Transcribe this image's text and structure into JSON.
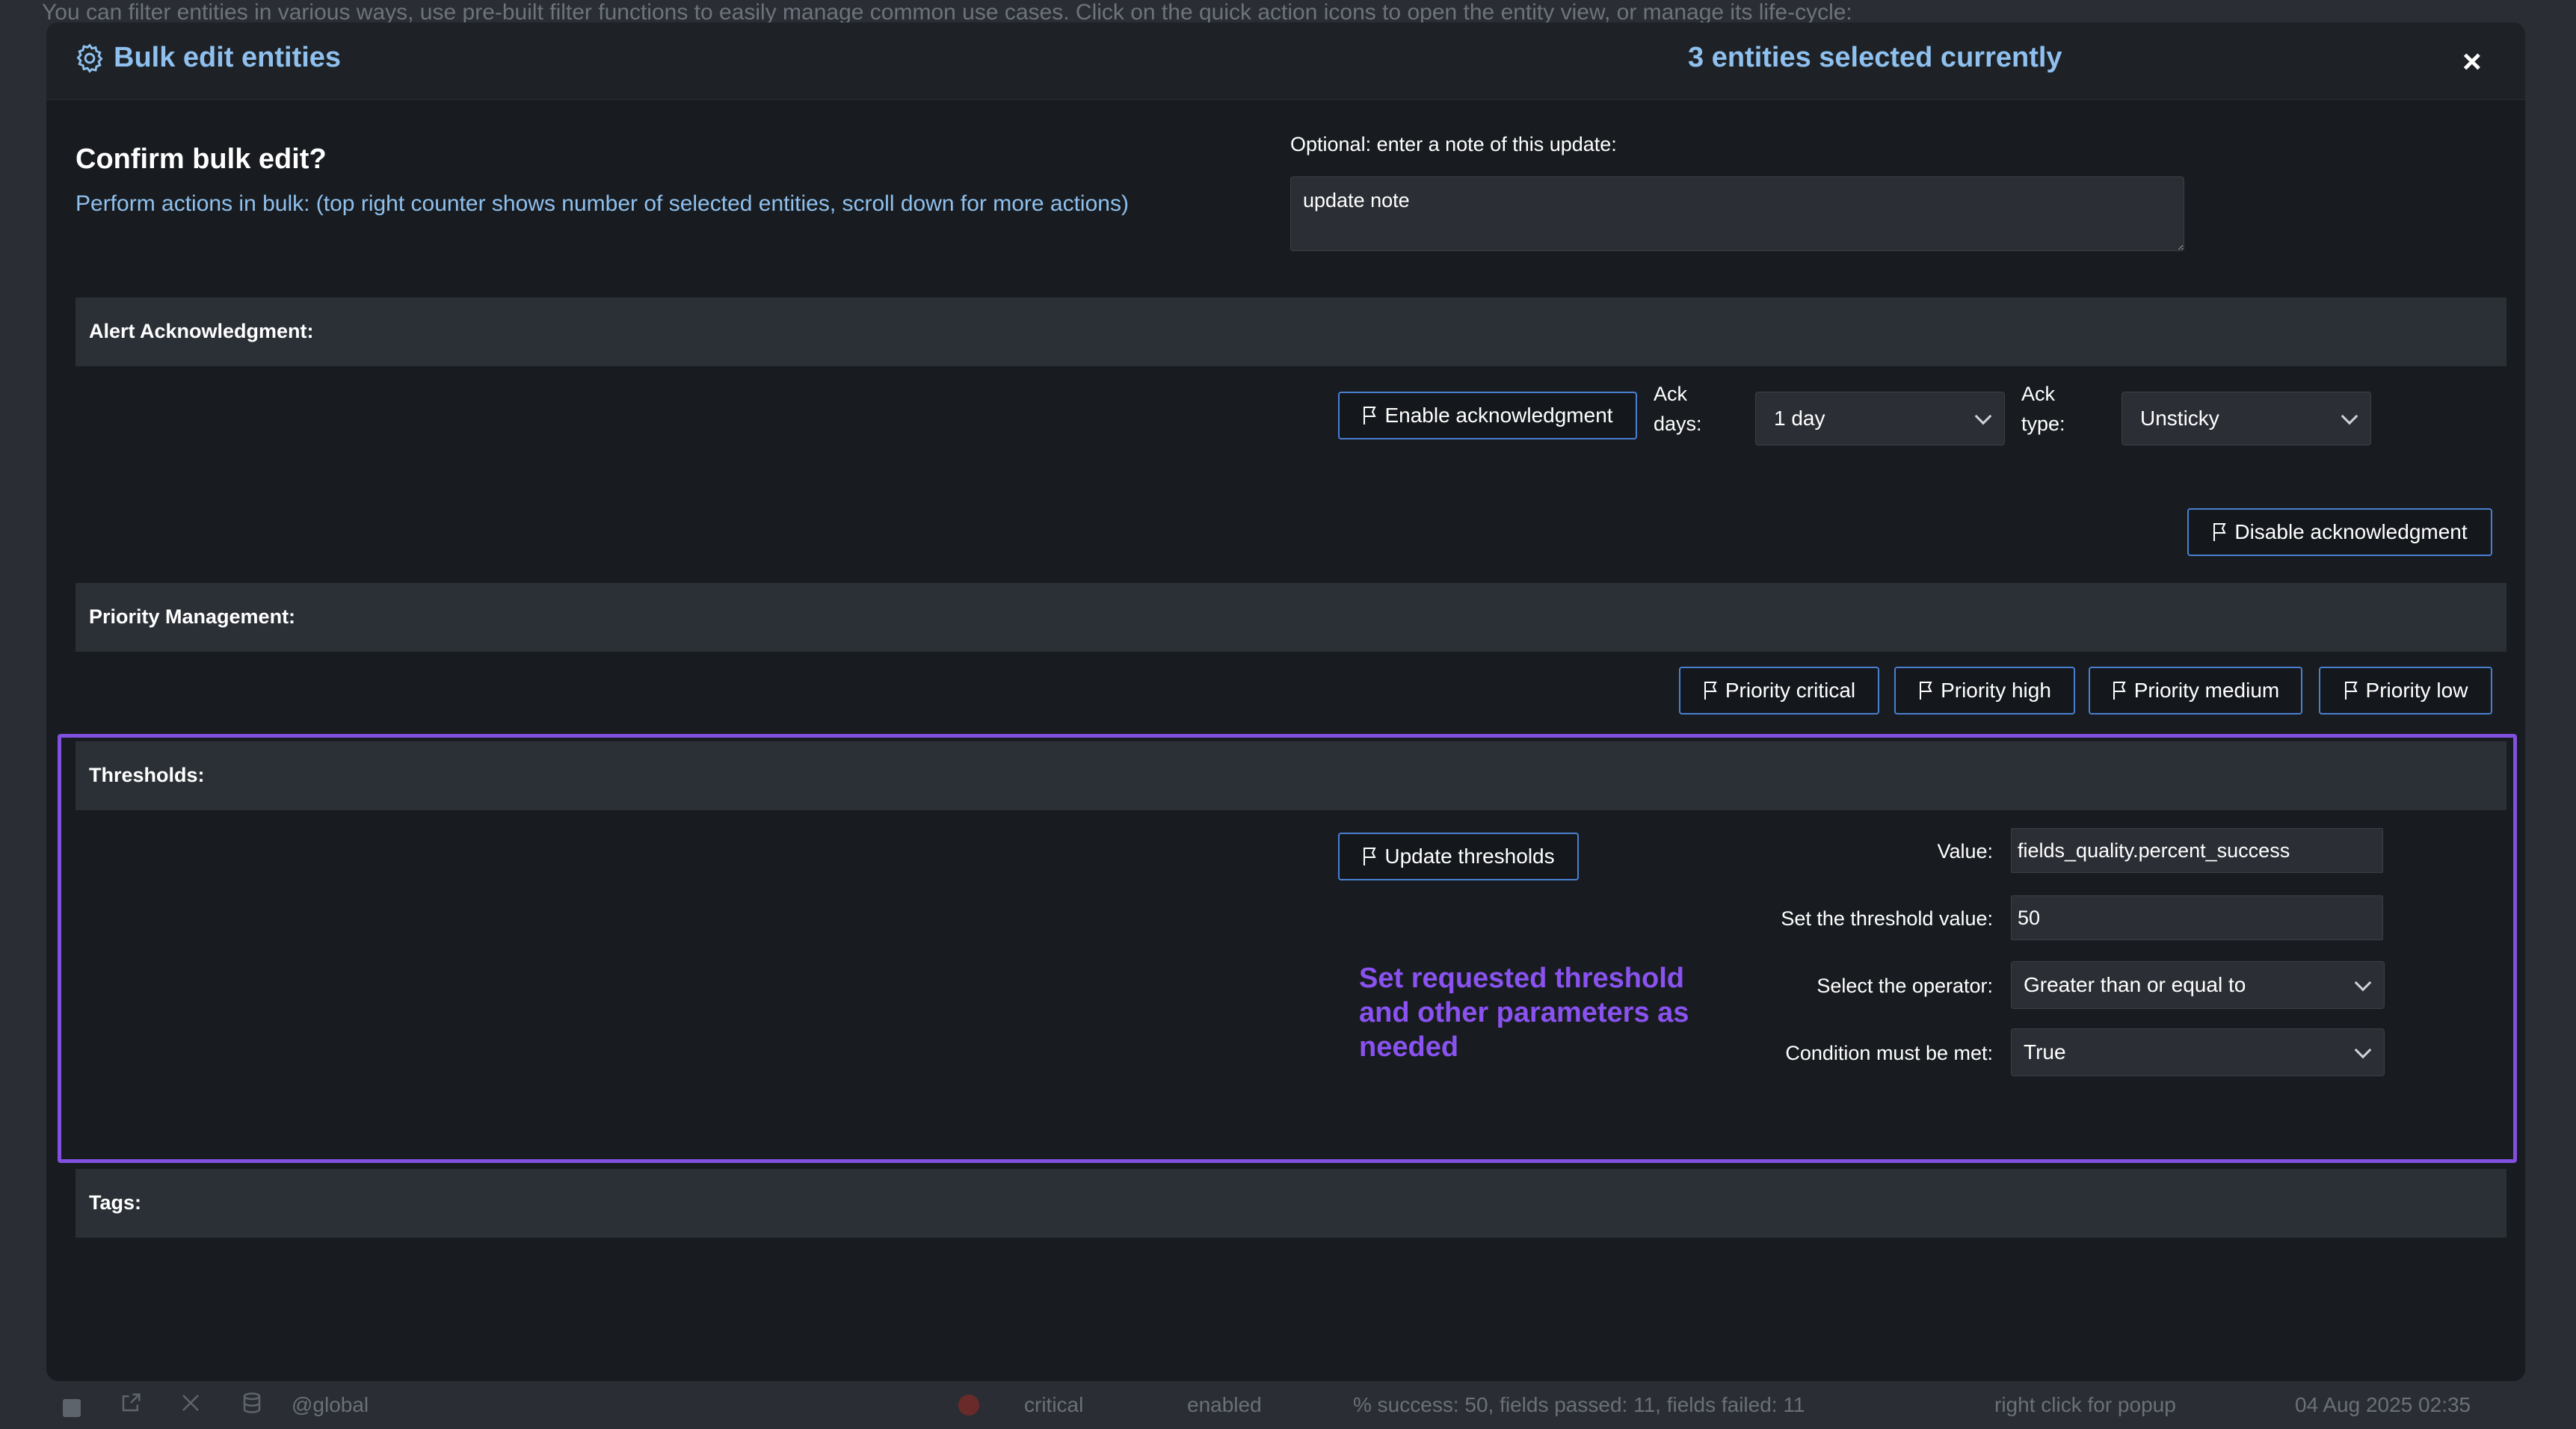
{
  "background": {
    "intro_text": "You can filter entities in various ways, use pre-built filter functions to easily manage common use cases. Click on the quick action icons to open the entity view, or manage its life-cycle:",
    "row": {
      "scope": "@global",
      "priority": "critical",
      "state": "enabled",
      "status_message": "% success: 50, fields passed: 11, fields failed: 11",
      "hint": "right click for popup",
      "timestamp": "04 Aug 2025 02:35"
    }
  },
  "modal": {
    "title": "Bulk edit entities",
    "selected_count": "3 entities selected currently",
    "close_label": "×",
    "confirm_title": "Confirm bulk edit?",
    "confirm_description": "Perform actions in bulk: (top right counter shows number of selected entities, scroll down for more actions)",
    "note_label": "Optional: enter a note of this update:",
    "note_value": "update note"
  },
  "alert_ack": {
    "section_title": "Alert Acknowledgment:",
    "enable_label": "Enable acknowledgment",
    "ack_days_label_1": "Ack",
    "ack_days_label_2": "days:",
    "ack_days_value": "1 day",
    "ack_type_label_1": "Ack",
    "ack_type_label_2": "type:",
    "ack_type_value": "Unsticky",
    "disable_label": "Disable acknowledgment"
  },
  "priority": {
    "section_title": "Priority Management:",
    "critical_label": "Priority critical",
    "high_label": "Priority high",
    "medium_label": "Priority medium",
    "low_label": "Priority low"
  },
  "thresholds": {
    "section_title": "Thresholds:",
    "update_label": "Update thresholds",
    "value_label": "Value:",
    "value_value": "fields_quality.percent_success",
    "threshold_label": "Set the threshold value:",
    "threshold_value": "50",
    "operator_label": "Select the operator:",
    "operator_value": "Greater than or equal to",
    "condition_label": "Condition must be met:",
    "condition_value": "True",
    "annotation": "Set requested threshold and other parameters as needed"
  },
  "tags": {
    "section_title": "Tags:"
  },
  "colors": {
    "accent_blue": "#8fc0ee",
    "button_border": "#4a7fd0",
    "highlight_purple": "#8050e0"
  }
}
